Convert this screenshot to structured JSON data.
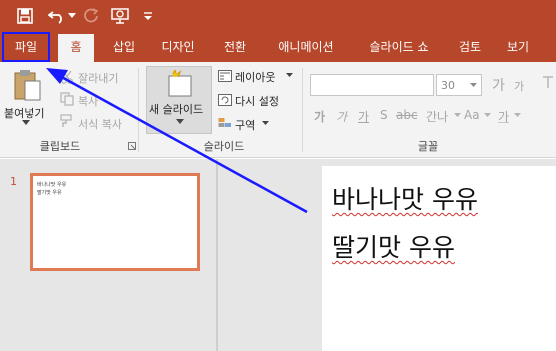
{
  "qat": {
    "icons": [
      "save-icon",
      "undo-icon",
      "redo-icon",
      "present-icon",
      "customize-icon"
    ],
    "colors": {
      "titlebar": "#b7472a",
      "ribbon": "#f3f3f3",
      "highlight": "#1a1aff",
      "arrow": "#1a1aff"
    }
  },
  "tabs": [
    "파일",
    "홈",
    "삽입",
    "디자인",
    "전환",
    "애니메이션",
    "슬라이드 쇼",
    "검토",
    "보기"
  ],
  "ribbon": {
    "clipboard": {
      "paste": "붙여넣기",
      "cut": "잘라내기",
      "copy": "복사",
      "format_painter": "서식 복사",
      "label": "클립보드"
    },
    "slides": {
      "new_slide": "새 슬라이드",
      "layout": "레이아웃",
      "reset": "다시 설정",
      "section": "구역",
      "label": "슬라이드"
    },
    "font": {
      "size": "30",
      "grow": "가",
      "shrink": "가",
      "label": "글꼴",
      "aa": "Aa",
      "gana": "간나"
    }
  },
  "thumbnails": [
    {
      "number": "1",
      "lines": [
        "바나나맛 우유",
        "딸기맛 우유"
      ]
    }
  ],
  "slide": {
    "lines": [
      "바나나맛 우유",
      "딸기맛 우유"
    ]
  }
}
